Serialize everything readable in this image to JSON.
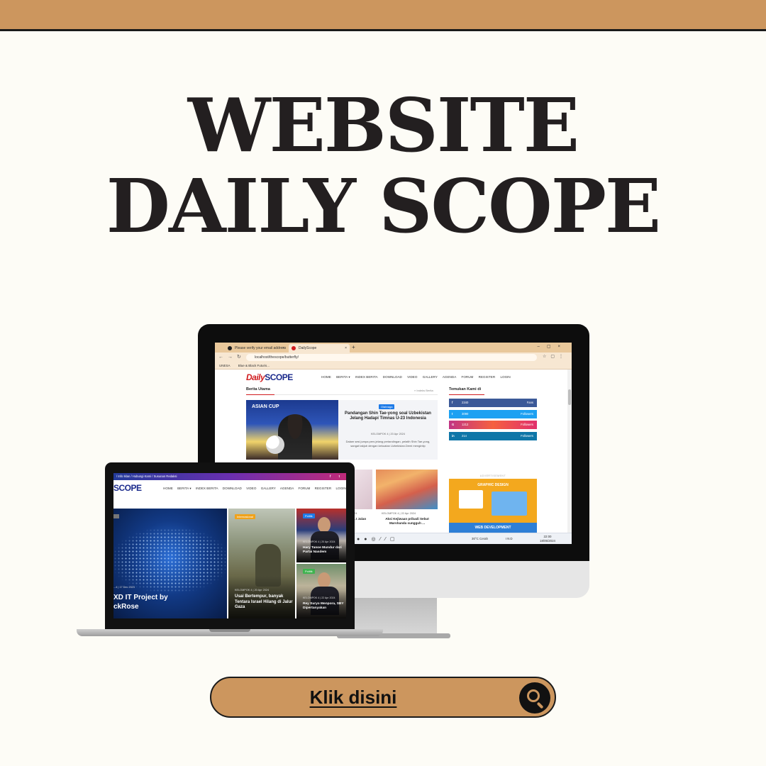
{
  "page": {
    "headline_line1": "WEBSITE",
    "headline_line2": "DAILY SCOPE",
    "cta_label": "Klik disini",
    "cta_icon": "search-icon",
    "colors": {
      "brand": "#cc965e",
      "background": "#fdfcf6",
      "text": "#231f20"
    }
  },
  "desktop": {
    "browser": {
      "tabs": [
        {
          "label": "Please verify your email address"
        },
        {
          "label": "DailyScope"
        }
      ],
      "url": "localhost/thescope/butterfly/",
      "bookmarks": [
        "UNESA",
        "Blue & Black Futuris..."
      ]
    },
    "site": {
      "logo_daily": "Daily",
      "logo_scope": "SCOPE",
      "nav": [
        "HOME",
        "BERITA ▾",
        "INDEX BERITA",
        "DOWNLOAD",
        "VIDEO",
        "GALLERY",
        "AGENDA",
        "FORUM",
        "REGISTER",
        "LOGIN"
      ],
      "main_section_title": "Berita Utama",
      "main_section_link": "» Indeks Berita",
      "featured": {
        "image_banner": "ASIAN CUP",
        "category": "Olahraga",
        "title": "Pandangan Shin Tae-yong soal Uzbekistan Jelang Hadapi Timnas U-23 Indonesia",
        "meta": "KELOMPOK 4 | 20 Apr 2024",
        "excerpt": "Dalam sesi jumpa pers jelang pertandingan, pelatih Shin Tae-yong, sangat takjub dengan kekuatan Uzbekistan.Demi mengintip"
      },
      "thumbs": [
        {
          "date": "2024",
          "title": "...t Jalan"
        },
        {
          "meta": "KELOMPOK 4 | 22 Apr 2024",
          "title": "Aksi Kejiwaan pribadi Sebut Marshanda sungguh ..."
        }
      ],
      "sidebar_title": "Temukan Kami di",
      "social": [
        {
          "icon": "f",
          "count": "2340",
          "label": "Fans",
          "color": "#3b5998"
        },
        {
          "icon": "t",
          "count": "3090",
          "label": "Followers",
          "color": "#1da1f2"
        },
        {
          "icon": "G",
          "count": "1212",
          "label": "Followers",
          "color": "#e1306c"
        },
        {
          "icon": "in",
          "count": "214",
          "label": "Followers",
          "color": "#0e76a8"
        }
      ],
      "ad_label": "ADVERTISEMENT",
      "ad_heading_1": "GRAPHIC DESIGN",
      "ad_heading_2": "WEB DEVELOPMENT"
    },
    "taskbar": {
      "weather": "30°C Cerah",
      "lang": "IND",
      "time": "22:00",
      "date": "18/05/2024"
    }
  },
  "laptop": {
    "topbar": "/ Info Iklan / Hubungi Kami / Susunan Redaksi",
    "logo": "SCOPE",
    "nav": [
      "HOME",
      "BERITA ▾",
      "INDEX BERITA",
      "DOWNLOAD",
      "VIDEO",
      "GALLERY",
      "AGENDA",
      "FORUM",
      "REGISTER",
      "LOGIN"
    ],
    "hero": {
      "meta": "...4 | 17 Dec 2023",
      "title_line1": "XD IT Project by",
      "title_line2": "ckRose"
    },
    "middle": {
      "category": "Internasional",
      "meta": "KELOMPOK 4 | 20 Apr 2024",
      "title": "Usai Bertempur, banyak Tentara Israel Hilang di Jalur Gaza"
    },
    "right_top": {
      "category": "Politik",
      "meta": "KELOMPOK 4 | 20 Apr 2024",
      "title": "Hary Tanoe Mundur dari Partai Nasdem"
    },
    "right_bottom": {
      "category": "Politik",
      "meta": "KELOMPOK 4 | 22 Apr 2024",
      "title": "Rey Suryo Menpora, SBY Dipertanyakan"
    }
  }
}
